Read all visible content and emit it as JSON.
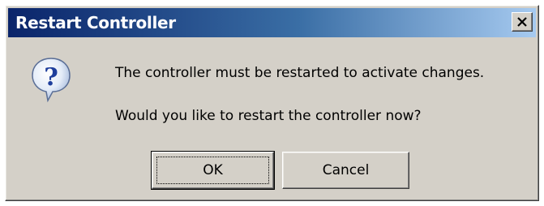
{
  "dialog": {
    "title": "Restart Controller",
    "icon": "question-icon",
    "message_line1": "The controller must be restarted to activate changes.",
    "message_line2": "Would you like to restart the controller now?",
    "buttons": {
      "ok_label": "OK",
      "cancel_label": "Cancel"
    },
    "close_icon": "close-icon"
  },
  "colors": {
    "titlebar_start": "#0a246a",
    "titlebar_end": "#a6caf0",
    "dialog_face": "#d4d0c8"
  }
}
